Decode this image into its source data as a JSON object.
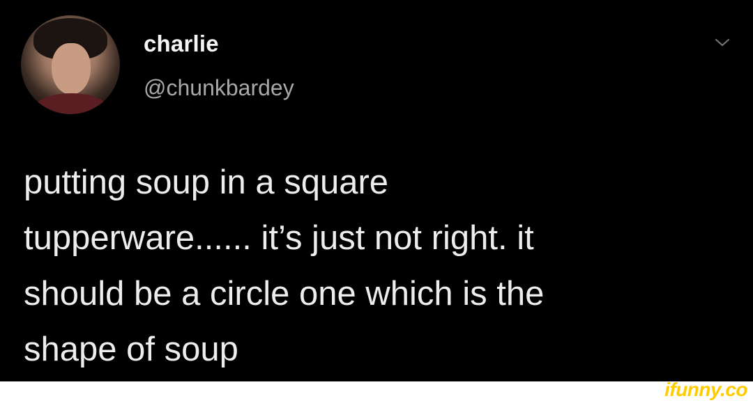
{
  "tweet": {
    "author": {
      "display_name": "charlie",
      "handle": "@chunkbardey",
      "avatar_icon": "profile-photo"
    },
    "menu_icon": "chevron-down-icon",
    "text": "putting soup in a square\ntupperware...... it’s just not right. it\nshould be a circle one which is the\nshape of soup"
  },
  "watermark": {
    "text": "ifunny.co"
  },
  "colors": {
    "background": "#000000",
    "primary_text": "#ededed",
    "secondary_text": "#a9a9a9",
    "watermark": "#ffcc00"
  }
}
